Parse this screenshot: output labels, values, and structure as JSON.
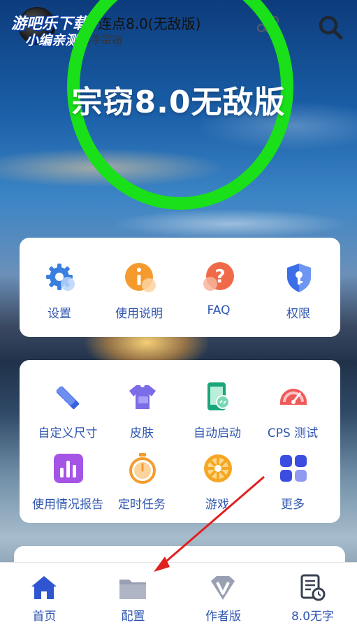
{
  "watermark": {
    "line1": "游吧乐下载",
    "line2": "小编亲测"
  },
  "header": {
    "title": "连点8.0(无敌版)",
    "subtitle": "化快手宗窃"
  },
  "hero": {
    "title": "宗窃8.0无敌版"
  },
  "card1": {
    "items": [
      {
        "label": "设置",
        "icon": "gear-icon"
      },
      {
        "label": "使用说明",
        "icon": "info-icon"
      },
      {
        "label": "FAQ",
        "icon": "question-icon"
      },
      {
        "label": "权限",
        "icon": "shield-key-icon"
      }
    ]
  },
  "card2": {
    "items": [
      {
        "label": "自定义尺寸",
        "icon": "ruler-pencil-icon"
      },
      {
        "label": "皮肤",
        "icon": "tshirt-icon"
      },
      {
        "label": "自动启动",
        "icon": "phone-link-icon"
      },
      {
        "label": "CPS 测试",
        "icon": "speedometer-icon"
      },
      {
        "label": "使用情况报告",
        "icon": "bar-chart-icon"
      },
      {
        "label": "定时任务",
        "icon": "stopwatch-icon"
      },
      {
        "label": "游戏",
        "icon": "wheel-icon"
      },
      {
        "label": "更多",
        "icon": "grid-icon"
      }
    ]
  },
  "bottom_nav": {
    "items": [
      {
        "label": "首页",
        "icon": "home-icon",
        "active": true
      },
      {
        "label": "配置",
        "icon": "folder-icon"
      },
      {
        "label": "作者版",
        "icon": "v-diamond-icon"
      },
      {
        "label": "8.0无字",
        "icon": "document-clock-icon"
      }
    ]
  },
  "colors": {
    "ring": "#19e019",
    "label_blue": "#2f56b0",
    "nav_active": "#2f56b0",
    "nav_inactive": "#9aa0b4",
    "annotation_arrow": "#e02020"
  }
}
